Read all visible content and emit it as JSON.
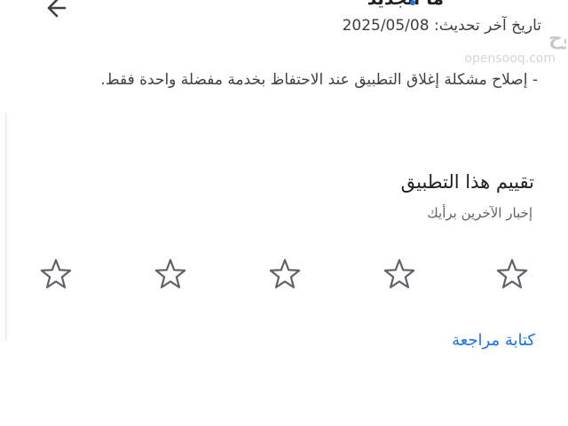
{
  "header": {
    "back_icon": "arrow-left-icon",
    "title": "ما الجديد",
    "updated_label": "تاريخ آخر تحديث",
    "updated_date": "2025/05/08"
  },
  "changelog": {
    "text": "- إصلاح مشكلة إغلاق التطبيق عند الاحتفاظ بخدمة مفضلة واحدة فقط."
  },
  "rating": {
    "title": "تقييم هذا التطبيق",
    "subtitle": "إخبار الآخرين برأيك",
    "stars": [
      {
        "icon": "star-outline-icon"
      },
      {
        "icon": "star-outline-icon"
      },
      {
        "icon": "star-outline-icon"
      },
      {
        "icon": "star-outline-icon"
      },
      {
        "icon": "star-outline-icon"
      }
    ],
    "selected": 0,
    "max": 5
  },
  "review": {
    "link_label": "كتابة مراجعة"
  },
  "watermark": {
    "brand": "السوق المفتوح",
    "domain": "opensooq.com"
  },
  "colors": {
    "accent": "#1a73e8",
    "text_primary": "#202124",
    "text_secondary": "#5f6368",
    "star_outline": "#5f6368"
  }
}
